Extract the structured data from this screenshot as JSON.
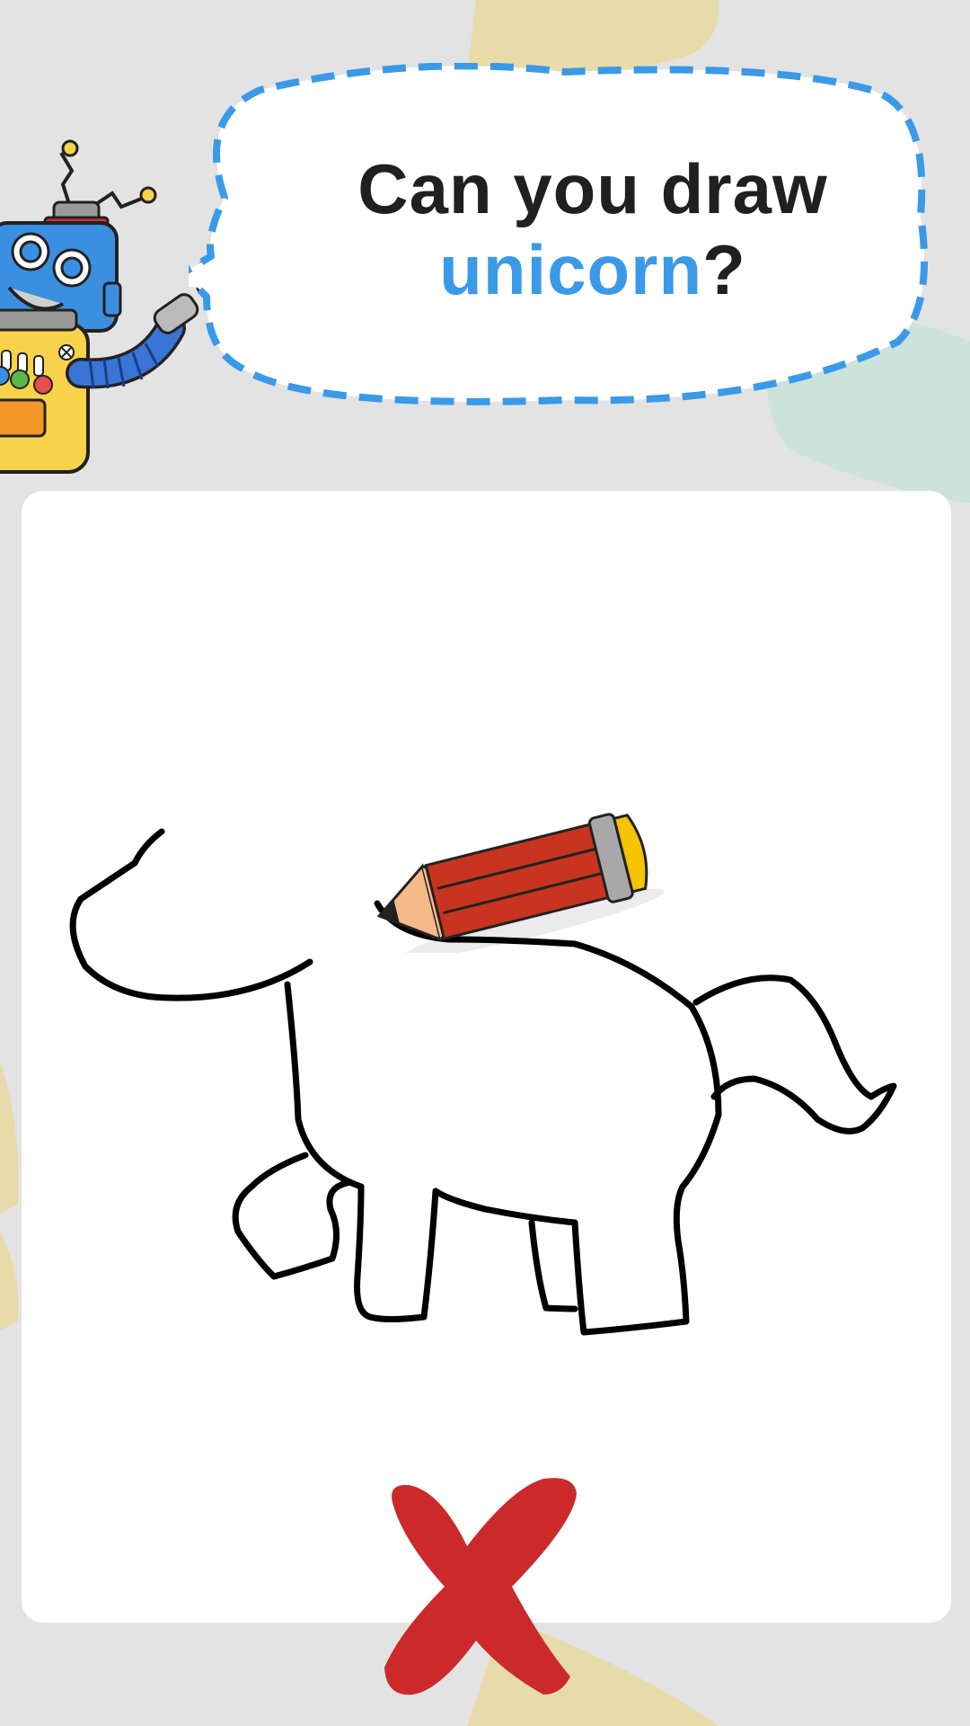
{
  "prompt": {
    "line1": "Can you draw",
    "subject": "unicorn",
    "suffix": "?"
  },
  "colors": {
    "background": "#e3e3e3",
    "subject_highlight": "#3a9ae8",
    "bubble_border": "#3a9ae8",
    "wrong_mark": "#cc2a2a"
  },
  "icons": {
    "mascot": "robot-mascot",
    "tool": "pencil-icon",
    "result": "cross-mark-icon"
  },
  "result": "wrong"
}
